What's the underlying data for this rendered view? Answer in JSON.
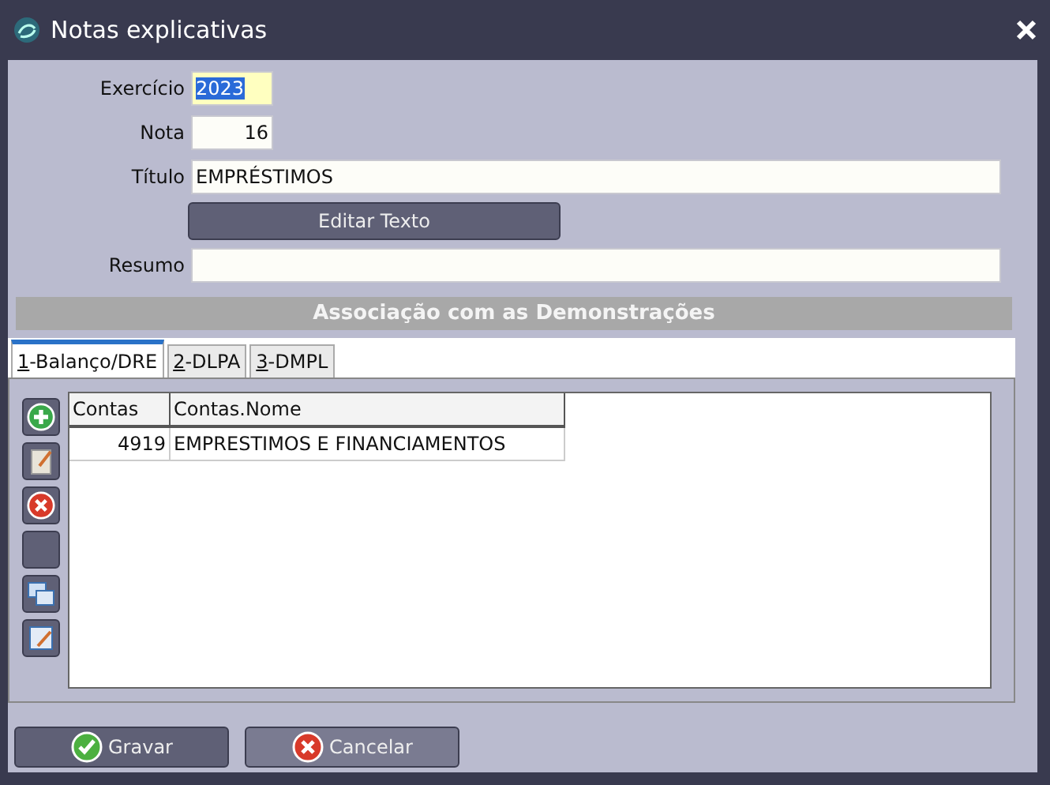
{
  "window": {
    "title": "Notas explicativas"
  },
  "fields": [
    {
      "label": "Exercício",
      "value": "2023",
      "kind": "year",
      "selected": true
    },
    {
      "label": "Nota",
      "value": "16",
      "kind": "number",
      "selected": false
    },
    {
      "label": "Título",
      "value": "EMPRÉSTIMOS",
      "kind": "text",
      "selected": false
    }
  ],
  "edit_button": {
    "label": "Editar Texto"
  },
  "summary": {
    "label": "Resumo"
  },
  "section": {
    "title": "Associação com as Demonstrações"
  },
  "tabs": [
    {
      "label": "1-Balanço/DRE",
      "selected": true
    },
    {
      "label": "2-DLPA",
      "selected": false
    },
    {
      "label": "3-DMPL",
      "selected": false
    }
  ],
  "toolbar": [
    {
      "kind": "add"
    },
    {
      "kind": "edit"
    },
    {
      "kind": "delete"
    },
    {
      "kind": "blank"
    },
    {
      "kind": "copy"
    },
    {
      "kind": "edit_form"
    }
  ],
  "table": {
    "columns": [
      "Contas",
      "Contas.Nome"
    ],
    "rows": [
      [
        "4919",
        "EMPRESTIMOS E FINANCIAMENTOS"
      ]
    ]
  },
  "buttons": [
    {
      "label": "Gravar",
      "kind": "ok",
      "highlighted": false
    },
    {
      "label": "Cancelar",
      "kind": "cancel",
      "highlighted": true
    }
  ]
}
